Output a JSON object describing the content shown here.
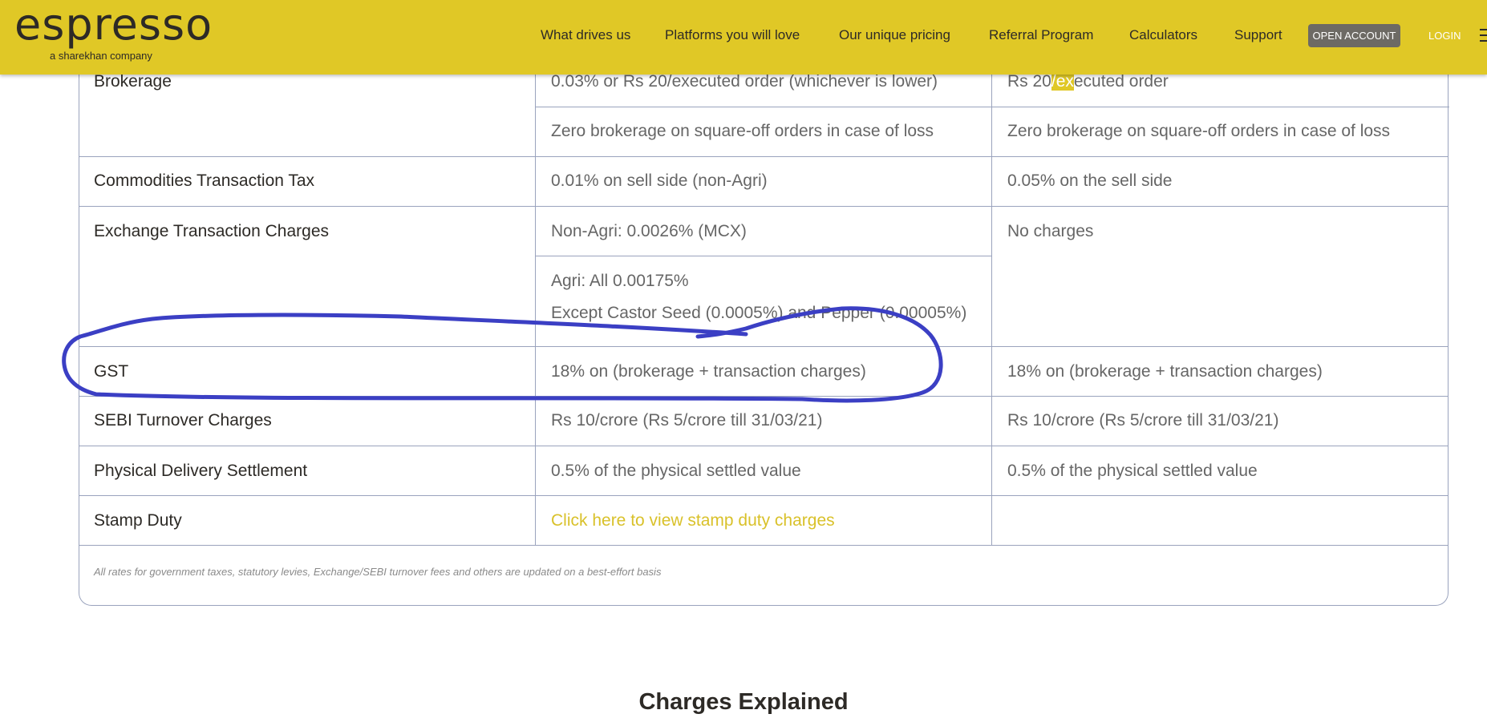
{
  "header": {
    "logo": "espresso",
    "logo_sub": "a sharekhan company",
    "nav": [
      "What drives us",
      "Platforms you will love",
      "Our unique pricing",
      "Referral Program",
      "Calculators",
      "Support"
    ],
    "open_account": "OPEN ACCOUNT",
    "login": "LOGIN",
    "menu_icon": "hamburger-icon"
  },
  "table": {
    "brokerage": {
      "label": "Brokerage",
      "c2_line1": "0.03% or Rs 20/executed order (whichever is lower)",
      "c3_line1_pre": "Rs 20",
      "c3_line1_hl": "/ex",
      "c3_line1_post": "ecuted order",
      "c2_line2": "Zero brokerage on square-off orders in case of loss",
      "c3_line2": "Zero brokerage on square-off orders in case of loss"
    },
    "ctt": {
      "label": "Commodities Transaction Tax",
      "c2": "0.01% on sell side (non-Agri)",
      "c3": "0.05% on the sell side"
    },
    "etc": {
      "label": "Exchange Transaction Charges",
      "c2_line1": "Non-Agri: 0.0026% (MCX)",
      "c2_line2": "Agri: All 0.00175%",
      "c2_line3": "Except Castor Seed (0.0005%) and Pepper (0.00005%)",
      "c3": "No charges"
    },
    "gst": {
      "label": "GST",
      "c2": "18% on (brokerage + transaction charges)",
      "c3": "18% on (brokerage + transaction charges)"
    },
    "sebi": {
      "label": "SEBI Turnover Charges",
      "c2": "Rs 10/crore (Rs 5/crore till 31/03/21)",
      "c3": "Rs 10/crore (Rs 5/crore till 31/03/21)"
    },
    "pds": {
      "label": "Physical Delivery Settlement",
      "c2": "0.5% of the physical settled value",
      "c3": "0.5% of the physical settled value"
    },
    "stamp": {
      "label": "Stamp Duty",
      "c2": "Click here to view stamp duty charges",
      "c3": ""
    },
    "footnote": "All rates for government taxes, statutory levies, Exchange/SEBI turnover fees and others are updated on a best-effort basis"
  },
  "section_title": "Charges Explained",
  "colors": {
    "brand": "#e0c826",
    "annotation": "#3b3fc4"
  }
}
